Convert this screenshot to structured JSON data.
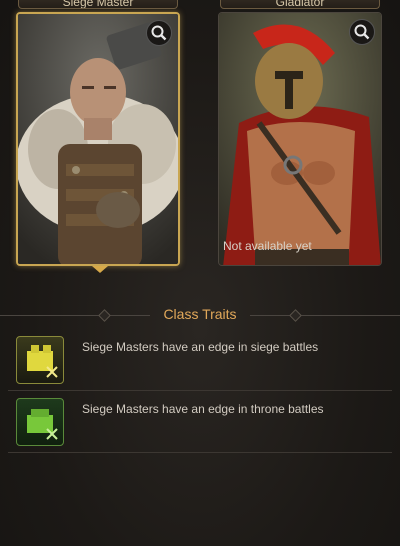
{
  "cards": [
    {
      "label": "Siege Master",
      "selected": true
    },
    {
      "label": "Gladiator",
      "selected": false,
      "status": "Not available yet"
    }
  ],
  "section": {
    "title": "Class Traits"
  },
  "traits": [
    {
      "text": "Siege Masters have an edge in siege battles",
      "icon": "siege-trait-icon",
      "color": "#d7cf3a"
    },
    {
      "text": "Siege Masters have an edge in throne battles",
      "icon": "throne-trait-icon",
      "color": "#7bcf3a"
    }
  ],
  "colors": {
    "accent": "#e1a85a",
    "selected_border": "#c9a652"
  }
}
